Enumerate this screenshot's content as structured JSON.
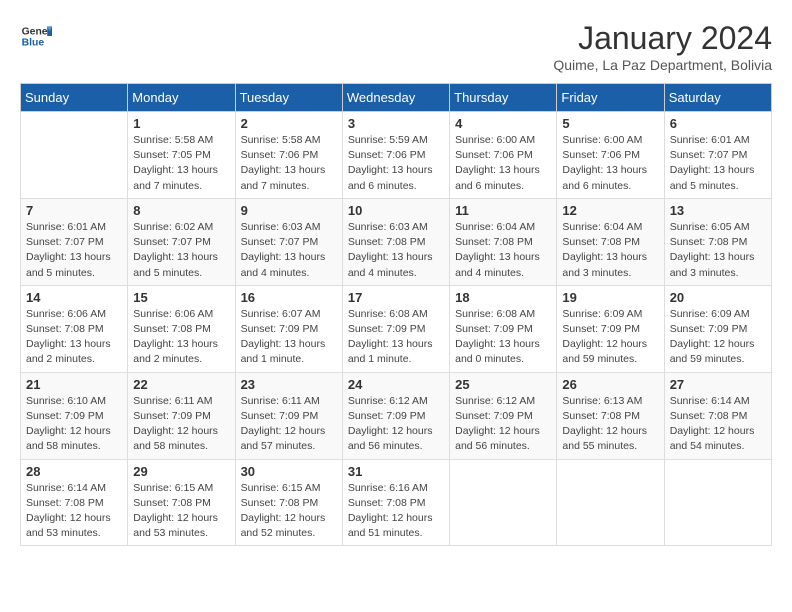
{
  "header": {
    "logo_line1": "General",
    "logo_line2": "Blue",
    "month_title": "January 2024",
    "subtitle": "Quime, La Paz Department, Bolivia"
  },
  "days_of_week": [
    "Sunday",
    "Monday",
    "Tuesday",
    "Wednesday",
    "Thursday",
    "Friday",
    "Saturday"
  ],
  "weeks": [
    [
      {
        "day": "",
        "info": ""
      },
      {
        "day": "1",
        "info": "Sunrise: 5:58 AM\nSunset: 7:05 PM\nDaylight: 13 hours\nand 7 minutes."
      },
      {
        "day": "2",
        "info": "Sunrise: 5:58 AM\nSunset: 7:06 PM\nDaylight: 13 hours\nand 7 minutes."
      },
      {
        "day": "3",
        "info": "Sunrise: 5:59 AM\nSunset: 7:06 PM\nDaylight: 13 hours\nand 6 minutes."
      },
      {
        "day": "4",
        "info": "Sunrise: 6:00 AM\nSunset: 7:06 PM\nDaylight: 13 hours\nand 6 minutes."
      },
      {
        "day": "5",
        "info": "Sunrise: 6:00 AM\nSunset: 7:06 PM\nDaylight: 13 hours\nand 6 minutes."
      },
      {
        "day": "6",
        "info": "Sunrise: 6:01 AM\nSunset: 7:07 PM\nDaylight: 13 hours\nand 5 minutes."
      }
    ],
    [
      {
        "day": "7",
        "info": "Sunrise: 6:01 AM\nSunset: 7:07 PM\nDaylight: 13 hours\nand 5 minutes."
      },
      {
        "day": "8",
        "info": "Sunrise: 6:02 AM\nSunset: 7:07 PM\nDaylight: 13 hours\nand 5 minutes."
      },
      {
        "day": "9",
        "info": "Sunrise: 6:03 AM\nSunset: 7:07 PM\nDaylight: 13 hours\nand 4 minutes."
      },
      {
        "day": "10",
        "info": "Sunrise: 6:03 AM\nSunset: 7:08 PM\nDaylight: 13 hours\nand 4 minutes."
      },
      {
        "day": "11",
        "info": "Sunrise: 6:04 AM\nSunset: 7:08 PM\nDaylight: 13 hours\nand 4 minutes."
      },
      {
        "day": "12",
        "info": "Sunrise: 6:04 AM\nSunset: 7:08 PM\nDaylight: 13 hours\nand 3 minutes."
      },
      {
        "day": "13",
        "info": "Sunrise: 6:05 AM\nSunset: 7:08 PM\nDaylight: 13 hours\nand 3 minutes."
      }
    ],
    [
      {
        "day": "14",
        "info": "Sunrise: 6:06 AM\nSunset: 7:08 PM\nDaylight: 13 hours\nand 2 minutes."
      },
      {
        "day": "15",
        "info": "Sunrise: 6:06 AM\nSunset: 7:08 PM\nDaylight: 13 hours\nand 2 minutes."
      },
      {
        "day": "16",
        "info": "Sunrise: 6:07 AM\nSunset: 7:09 PM\nDaylight: 13 hours\nand 1 minute."
      },
      {
        "day": "17",
        "info": "Sunrise: 6:08 AM\nSunset: 7:09 PM\nDaylight: 13 hours\nand 1 minute."
      },
      {
        "day": "18",
        "info": "Sunrise: 6:08 AM\nSunset: 7:09 PM\nDaylight: 13 hours\nand 0 minutes."
      },
      {
        "day": "19",
        "info": "Sunrise: 6:09 AM\nSunset: 7:09 PM\nDaylight: 12 hours\nand 59 minutes."
      },
      {
        "day": "20",
        "info": "Sunrise: 6:09 AM\nSunset: 7:09 PM\nDaylight: 12 hours\nand 59 minutes."
      }
    ],
    [
      {
        "day": "21",
        "info": "Sunrise: 6:10 AM\nSunset: 7:09 PM\nDaylight: 12 hours\nand 58 minutes."
      },
      {
        "day": "22",
        "info": "Sunrise: 6:11 AM\nSunset: 7:09 PM\nDaylight: 12 hours\nand 58 minutes."
      },
      {
        "day": "23",
        "info": "Sunrise: 6:11 AM\nSunset: 7:09 PM\nDaylight: 12 hours\nand 57 minutes."
      },
      {
        "day": "24",
        "info": "Sunrise: 6:12 AM\nSunset: 7:09 PM\nDaylight: 12 hours\nand 56 minutes."
      },
      {
        "day": "25",
        "info": "Sunrise: 6:12 AM\nSunset: 7:09 PM\nDaylight: 12 hours\nand 56 minutes."
      },
      {
        "day": "26",
        "info": "Sunrise: 6:13 AM\nSunset: 7:08 PM\nDaylight: 12 hours\nand 55 minutes."
      },
      {
        "day": "27",
        "info": "Sunrise: 6:14 AM\nSunset: 7:08 PM\nDaylight: 12 hours\nand 54 minutes."
      }
    ],
    [
      {
        "day": "28",
        "info": "Sunrise: 6:14 AM\nSunset: 7:08 PM\nDaylight: 12 hours\nand 53 minutes."
      },
      {
        "day": "29",
        "info": "Sunrise: 6:15 AM\nSunset: 7:08 PM\nDaylight: 12 hours\nand 53 minutes."
      },
      {
        "day": "30",
        "info": "Sunrise: 6:15 AM\nSunset: 7:08 PM\nDaylight: 12 hours\nand 52 minutes."
      },
      {
        "day": "31",
        "info": "Sunrise: 6:16 AM\nSunset: 7:08 PM\nDaylight: 12 hours\nand 51 minutes."
      },
      {
        "day": "",
        "info": ""
      },
      {
        "day": "",
        "info": ""
      },
      {
        "day": "",
        "info": ""
      }
    ]
  ]
}
